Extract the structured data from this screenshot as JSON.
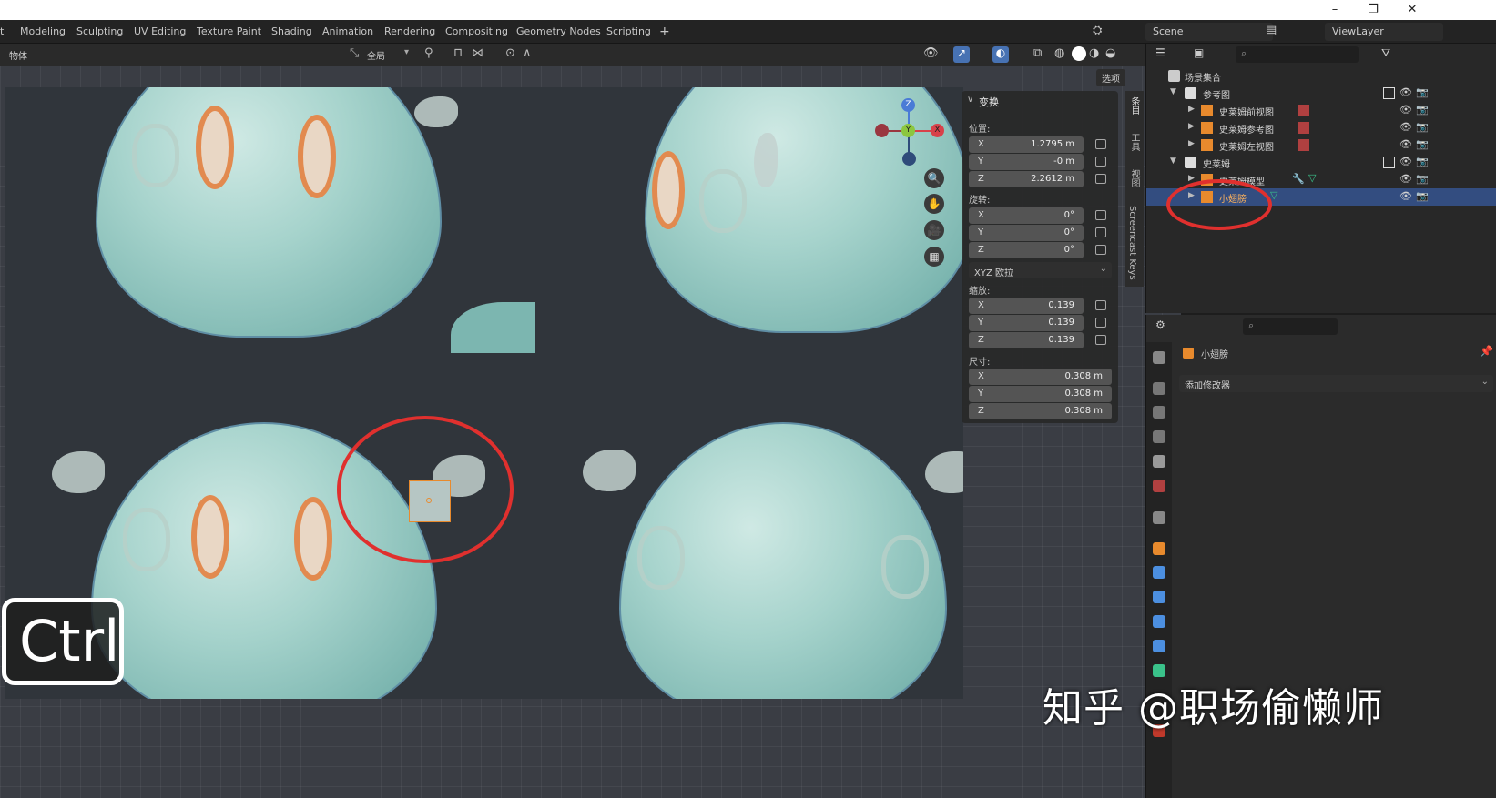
{
  "titlebar": {
    "minimize": "–",
    "maximize": "❐",
    "close": "✕"
  },
  "workspace_tabs": [
    "t",
    "Modeling",
    "Sculpting",
    "UV Editing",
    "Texture Paint",
    "Shading",
    "Animation",
    "Rendering",
    "Compositing",
    "Geometry Nodes",
    "Scripting"
  ],
  "add_tab": "+",
  "scene_name": "Scene",
  "viewlayer_name": "ViewLayer",
  "viewport_header": {
    "mode": "物体",
    "transform_orientation": "全局",
    "options_label": "选项"
  },
  "npanel": {
    "title": "变换",
    "location_label": "位置:",
    "location": {
      "x": "1.2795 m",
      "y": "-0 m",
      "z": "2.2612 m"
    },
    "rotation_label": "旋转:",
    "rotation": {
      "x": "0°",
      "y": "0°",
      "z": "0°"
    },
    "rotation_mode": "XYZ 欧拉",
    "scale_label": "缩放:",
    "scale": {
      "x": "0.139",
      "y": "0.139",
      "z": "0.139"
    },
    "dimensions_label": "尺寸:",
    "dimensions": {
      "x": "0.308 m",
      "y": "0.308 m",
      "z": "0.308 m"
    },
    "axis_labels": {
      "x": "X",
      "y": "Y",
      "z": "Z"
    }
  },
  "side_tabs": [
    "条目",
    "工具",
    "视图",
    "Screencast Keys"
  ],
  "gizmo_labels": {
    "z": "Z",
    "y": "Y",
    "x": "X"
  },
  "outliner": {
    "root": "场景集合",
    "items": [
      {
        "label": "参考图",
        "kind": "collection"
      },
      {
        "label": "史莱姆前视图",
        "kind": "empty-image"
      },
      {
        "label": "史莱姆参考图",
        "kind": "empty-image"
      },
      {
        "label": "史莱姆左视图",
        "kind": "empty-image"
      },
      {
        "label": "史莱姆",
        "kind": "collection"
      },
      {
        "label": "史莱姆模型",
        "kind": "mesh"
      },
      {
        "label": "小翅膀",
        "kind": "mesh",
        "selected": true
      }
    ]
  },
  "properties": {
    "object_name": "小翅膀",
    "add_modifier": "添加修改器"
  },
  "overlay": {
    "key": "Ctrl",
    "watermark": "知乎 @职场偷懒师"
  },
  "colors": {
    "accent": "#e0302e",
    "selection": "#334d80",
    "blender_orange": "#e88a2d"
  }
}
